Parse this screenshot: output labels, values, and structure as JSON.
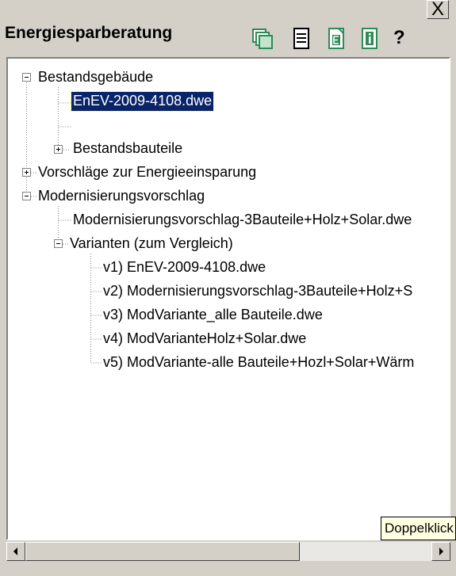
{
  "panel": {
    "title": "Energiesparberatung",
    "close_label": "X",
    "toolbar": [
      {
        "name": "layers-icon",
        "color": "#2e8b57"
      },
      {
        "name": "document-list-icon",
        "color": "#000000"
      },
      {
        "name": "e-document-icon",
        "color": "#2e8b57"
      },
      {
        "name": "info-icon",
        "color": "#2e8b57"
      }
    ],
    "help_label": "?"
  },
  "tree": {
    "nodes": [
      {
        "label": "Bestandsgebäude",
        "expander": "minus"
      },
      {
        "label": "EnEV-2009-4108.dwe",
        "selected": true
      },
      {
        "label": ""
      },
      {
        "label": "Bestandsbauteile",
        "expander": "plus"
      },
      {
        "label": "Vorschläge zur Energieeinsparung",
        "expander": "plus"
      },
      {
        "label": "Modernisierungsvorschlag",
        "expander": "minus"
      },
      {
        "label": "Modernisierungsvorschlag-3Bauteile+Holz+Solar.dwe"
      },
      {
        "label": "Varianten (zum Vergleich)",
        "expander": "minus"
      },
      {
        "label": "v1) EnEV-2009-4108.dwe"
      },
      {
        "label": "v2) Modernisierungsvorschlag-3Bauteile+Holz+S"
      },
      {
        "label": "v3) ModVariante_alle Bauteile.dwe"
      },
      {
        "label": "v4) ModVarianteHolz+Solar.dwe"
      },
      {
        "label": "v5) ModVariante-alle Bauteile+Hozl+Solar+Wärm"
      }
    ]
  },
  "tooltip": {
    "text": "Doppelklick"
  },
  "scrollbar": {
    "left_icon": "arrow-left-icon",
    "right_icon": "arrow-right-icon"
  }
}
